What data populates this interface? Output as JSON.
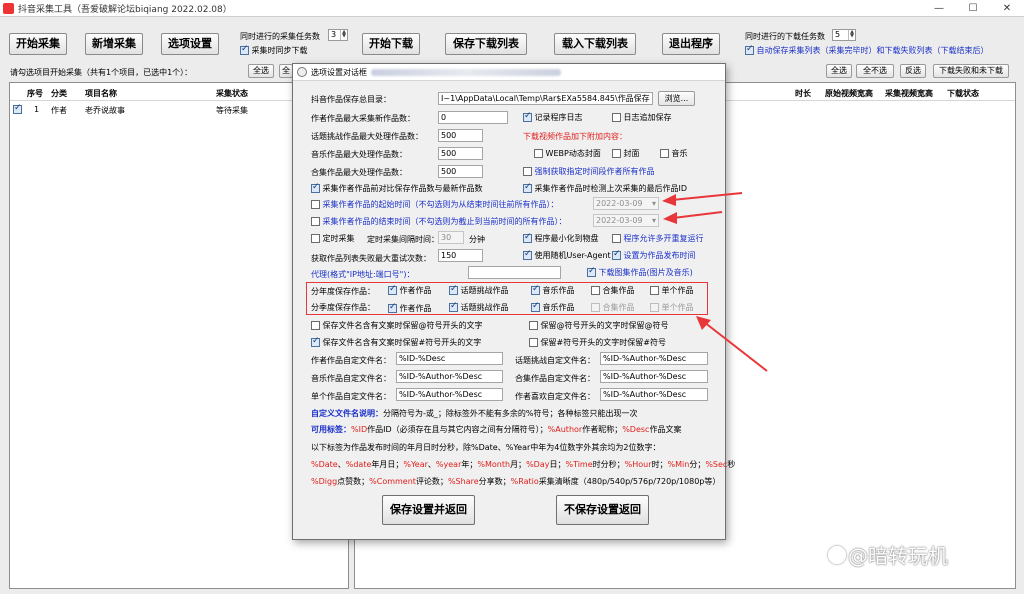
{
  "window": {
    "title": "抖音采集工具（吾爱破解论坛biqiang 2022.02.08）",
    "controls": {
      "minimize": "—",
      "maximize": "☐",
      "close": "✕"
    }
  },
  "toolbar": {
    "start_collect": "开始采集",
    "new_collect": "新增采集",
    "options": "选项设置",
    "concurrent_collect_label": "同时进行的采集任务数",
    "concurrent_collect_value": "3",
    "realtime_sync_label": "采集时同步下载",
    "start_download": "开始下载",
    "save_download_list": "保存下载列表",
    "load_download_list": "载入下载列表",
    "exit": "退出程序",
    "concurrent_download_label": "同时进行的下载任务数",
    "concurrent_download_value": "5",
    "autosave_label": "自动保存采集列表（采集完毕时）和下载失败列表（下载结束后）"
  },
  "left_panel": {
    "hint": "请勾选项目开始采集（共有1个项目，已选中1个）：",
    "select_all": "全选",
    "select_none": "全",
    "headers": [
      "序号",
      "分类",
      "项目名称",
      "采集状态"
    ],
    "rows": [
      {
        "index": "1",
        "category": "作者",
        "name": "老乔说故事",
        "status": "等待采集"
      }
    ]
  },
  "right_panel": {
    "select_all": "全选",
    "select_none": "全不选",
    "invert": "反选",
    "download_failed": "下载失败和未下载",
    "headers": [
      "时长",
      "原始视频宽高",
      "采集视频宽高",
      "下载状态"
    ]
  },
  "dialog": {
    "title": "选项设置对话框",
    "save_dir_label": "抖音作品保存总目录：",
    "save_dir_value": "I~1\\AppData\\Local\\Temp\\Rar$EXa5584.845\\作品保存",
    "browse": "浏览...",
    "author_max_new_label": "作者作品最大采集新作品数：",
    "author_max_new_value": "0",
    "record_log": "记录程序日志",
    "append_log": "日志追加保存",
    "topic_max_label": "话题挑战作品最大处理作品数：",
    "topic_max_value": "500",
    "extra_content_title": "下载视频作品加下附加内容：",
    "music_max_label": "音乐作品最大处理作品数：",
    "music_max_value": "500",
    "webp_cover": "WEBP动态封面",
    "cover": "封面",
    "music": "音乐",
    "collection_max_label": "合集作品最大处理作品数：",
    "collection_max_value": "500",
    "force_get_all": "强制获取指定时间段作者所有作品",
    "compare_latest": "采集作者作品前对比保存作品数与最新作品数",
    "check_last_id": "采集作者作品时检测上次采集的最后作品ID",
    "start_time_label": "采集作者作品的起始时间（不勾选则为从结束时间往前所有作品）：",
    "start_time_value": "2022-03-09",
    "end_time_label": "采集作者作品的结束时间（不勾选则为截止到当前时间的所有作品）：",
    "end_time_value": "2022-03-09",
    "timed_collect": "定时采集",
    "timed_interval_label": "定时采集间隔时间：",
    "timed_interval_value": "30",
    "minutes": "分钟",
    "minimize_tray": "程序最小化到物盘",
    "allow_multi": "程序允许多开重复运行",
    "retry_label": "获取作品列表失败最大重试次数：",
    "retry_value": "150",
    "random_ua": "使用随机User-Agent",
    "set_publish_time": "设置为作品发布时间",
    "proxy_label": "代理(格式\"IP地址:端口号\")：",
    "proxy_value": "",
    "download_gallery": "下载图集作品(图片及音乐)",
    "yearly_label": "分年度保存作品：",
    "quarterly_label": "分季度保存作品：",
    "cat_author": "作者作品",
    "cat_topic": "话题挑战作品",
    "cat_music": "音乐作品",
    "cat_collection": "合集作品",
    "cat_single": "单个作品",
    "keep_at_prefix": "保存文件名含有文案时保留@符号开头的文字",
    "keep_at_symbol": "保留@符号开头的文字时保留@符号",
    "keep_hash_prefix": "保存文件名含有文案时保留#符号开头的文字",
    "keep_hash_symbol": "保留#符号开头的文字时保留#符号",
    "author_fname_label": "作者作品自定文件名：",
    "author_fname_value": "%ID-%Desc",
    "topic_fname_label": "话题挑战自定文件名：",
    "topic_fname_value": "%ID-%Author-%Desc",
    "music_fname_label": "音乐作品自定文件名：",
    "music_fname_value": "%ID-%Author-%Desc",
    "collection_fname_label": "合集作品自定文件名：",
    "collection_fname_value": "%ID-%Author-%Desc",
    "single_fname_label": "单个作品自定文件名：",
    "single_fname_value": "%ID-%Author-%Desc",
    "liked_fname_label": "作者喜欢自定文件名：",
    "liked_fname_value": "%ID-%Author-%Desc",
    "custom_desc_title": "自定义文件名说明：",
    "custom_desc_text": "分隔符号为-或_；除标签外不能有多余的%符号；各种标签只能出现一次",
    "tags_title": "可用标签：",
    "tag_id": "%ID",
    "tag_id_desc": "作品ID（必须存在且与其它内容之间有分隔符号）；",
    "tag_author": "%Author",
    "tag_author_desc": "作者昵称；",
    "tag_desc": "%Desc",
    "tag_desc_desc": "作品文案",
    "time_tags_intro": "以下标签为作品发布时间的年月日时分秒，除%Date、%Year中年为4位数字外其余均为2位数字：",
    "line_a": [
      {
        "t": "%Date",
        "r": true
      },
      {
        "t": "、",
        "r": false
      },
      {
        "t": "%date",
        "r": true
      },
      {
        "t": "年月日；",
        "r": false
      },
      {
        "t": "%Year",
        "r": true
      },
      {
        "t": "、",
        "r": false
      },
      {
        "t": "%year",
        "r": true
      },
      {
        "t": "年；",
        "r": false
      },
      {
        "t": "%Month",
        "r": true
      },
      {
        "t": "月；",
        "r": false
      },
      {
        "t": "%Day",
        "r": true
      },
      {
        "t": "日；",
        "r": false
      },
      {
        "t": "%Time",
        "r": true
      },
      {
        "t": "时分秒；",
        "r": false
      },
      {
        "t": "%Hour",
        "r": true
      },
      {
        "t": "时；",
        "r": false
      },
      {
        "t": "%Min",
        "r": true
      },
      {
        "t": "分；",
        "r": false
      },
      {
        "t": "%Sec",
        "r": true
      },
      {
        "t": "秒",
        "r": false
      }
    ],
    "line_b": [
      {
        "t": "%Digg",
        "r": true
      },
      {
        "t": "点赞数；",
        "r": false
      },
      {
        "t": "%Comment",
        "r": true
      },
      {
        "t": "评论数；",
        "r": false
      },
      {
        "t": "%Share",
        "r": true
      },
      {
        "t": "分享数；",
        "r": false
      },
      {
        "t": "%Ratio",
        "r": true
      },
      {
        "t": "采集清晰度（480p/540p/576p/720p/1080p等）",
        "r": false
      }
    ],
    "save_return": "保存设置并返回",
    "nosave_return": "不保存设置返回"
  },
  "watermark": "@暗转玩机",
  "colors": {
    "annotation_red": "#e8373a",
    "link_blue": "#1a2fc9",
    "tag_red": "#e0201c"
  }
}
